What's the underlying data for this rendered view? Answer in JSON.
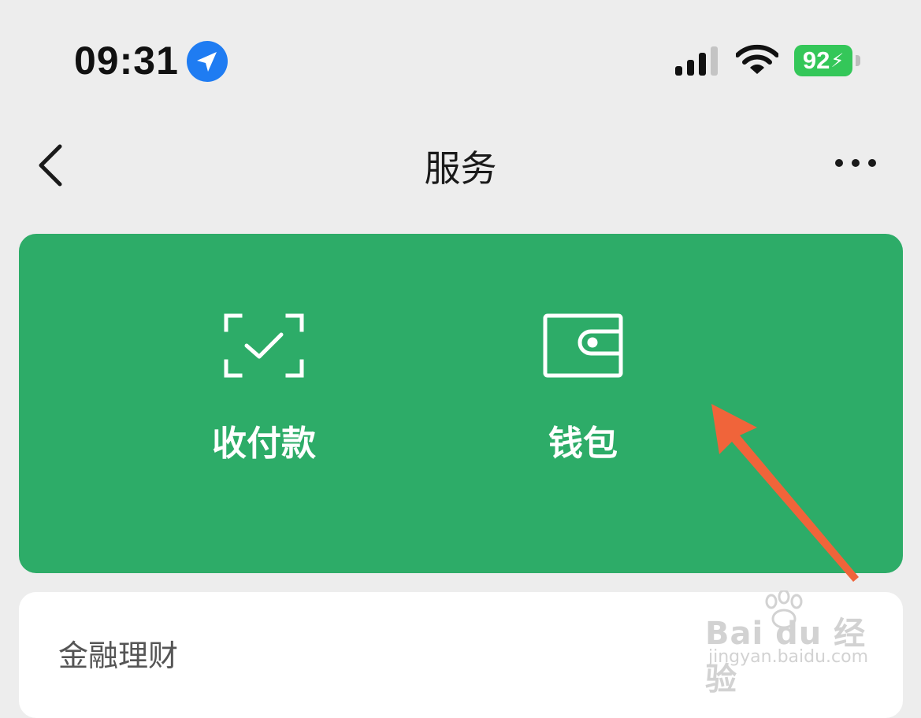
{
  "status_bar": {
    "time": "09:31",
    "battery": "92",
    "icons": [
      "location-arrow-icon",
      "cellular-signal-icon",
      "wifi-icon",
      "battery-icon"
    ]
  },
  "nav": {
    "title": "服务",
    "back_icon": "chevron-left-icon",
    "more_icon": "more-dots-icon"
  },
  "green_card": {
    "color": "#2dac68",
    "items": [
      {
        "label": "收付款",
        "icon": "scan-check-icon"
      },
      {
        "label": "钱包",
        "icon": "wallet-icon"
      }
    ]
  },
  "finance_section": {
    "title": "金融理财"
  },
  "watermark": {
    "main": "Bai du 经验",
    "sub": "jingyan.baidu.com"
  },
  "annotation": {
    "arrow_color": "#f0643a"
  }
}
